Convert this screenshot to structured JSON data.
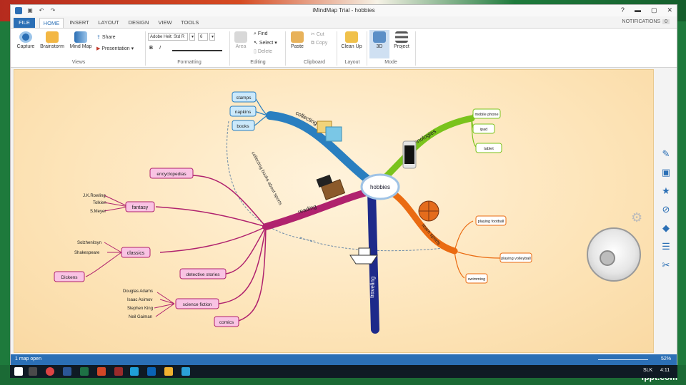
{
  "app": {
    "title": "iMindMap Trial - hobbies",
    "notifications_label": "NOTIFICATIONS",
    "notifications_count": "0",
    "help": "?",
    "minimize": "▬",
    "maximize": "▢",
    "close": "✕"
  },
  "tabs": [
    "FILE",
    "HOME",
    "INSERT",
    "LAYOUT",
    "DESIGN",
    "VIEW",
    "TOOLS"
  ],
  "ribbon": {
    "views": {
      "label": "Views",
      "capture": "Capture",
      "brainstorm": "Brainstorm",
      "mindmap": "Mind Map",
      "share": "Share",
      "presentation": "Presentation ▾"
    },
    "formatting": {
      "label": "Formatting",
      "font": "Adobe Heit: Std R",
      "size": "6"
    },
    "editing": {
      "label": "Editing",
      "area": "Area",
      "find": "Find",
      "select": "Select ▾",
      "delete": "Delete"
    },
    "clipboard": {
      "label": "Clipboard",
      "paste": "Paste",
      "cut": "Cut",
      "copy": "Copy"
    },
    "layout": {
      "label": "Layout",
      "cleanup": "Clean Up"
    },
    "mode": {
      "label": "Mode",
      "3d": "3D",
      "project": "Project"
    }
  },
  "mindmap": {
    "central": "hobbies",
    "branches": {
      "collecting": "collecting",
      "technologies": "technologies",
      "reading": "reading",
      "sports": "team sports",
      "traveling": "traveling",
      "relationship": "collecting books about sports"
    },
    "collecting_items": [
      "stamps",
      "napkins",
      "books"
    ],
    "tech_items": [
      "mobile phone",
      "ipad",
      "tablet"
    ],
    "sports_items": [
      "playing football",
      "playing volleyball",
      "swimming"
    ],
    "reading_items": {
      "encyclopedias": "encyclopedias",
      "fantasy": "fantasy",
      "fantasy_authors": [
        "J.K.Rowling",
        "Tolkien",
        "S.Meyer"
      ],
      "classics": "classics",
      "classics_authors": [
        "Solzhenitsyn",
        "Shakespeare"
      ],
      "dickens": "Dickens",
      "detective": "detective stories",
      "science_fiction": "science fiction",
      "scifi_authors": [
        "Douglas Adams",
        "Isaac Asimov",
        "Stephen King",
        "Neil Gaiman"
      ],
      "comics": "comics"
    }
  },
  "status": {
    "maps_open": "1 map open",
    "zoom": "52%"
  },
  "taskbar": {
    "lang": "SLK",
    "time": "4:11"
  },
  "watermark": "fppt.com",
  "colors": {
    "collecting": "#2a7fc0",
    "technologies": "#7ac31c",
    "reading": "#b0226e",
    "sports": "#ea6b12",
    "traveling": "#1e2a8a",
    "ribbon_accent": "#2b6fb5"
  }
}
